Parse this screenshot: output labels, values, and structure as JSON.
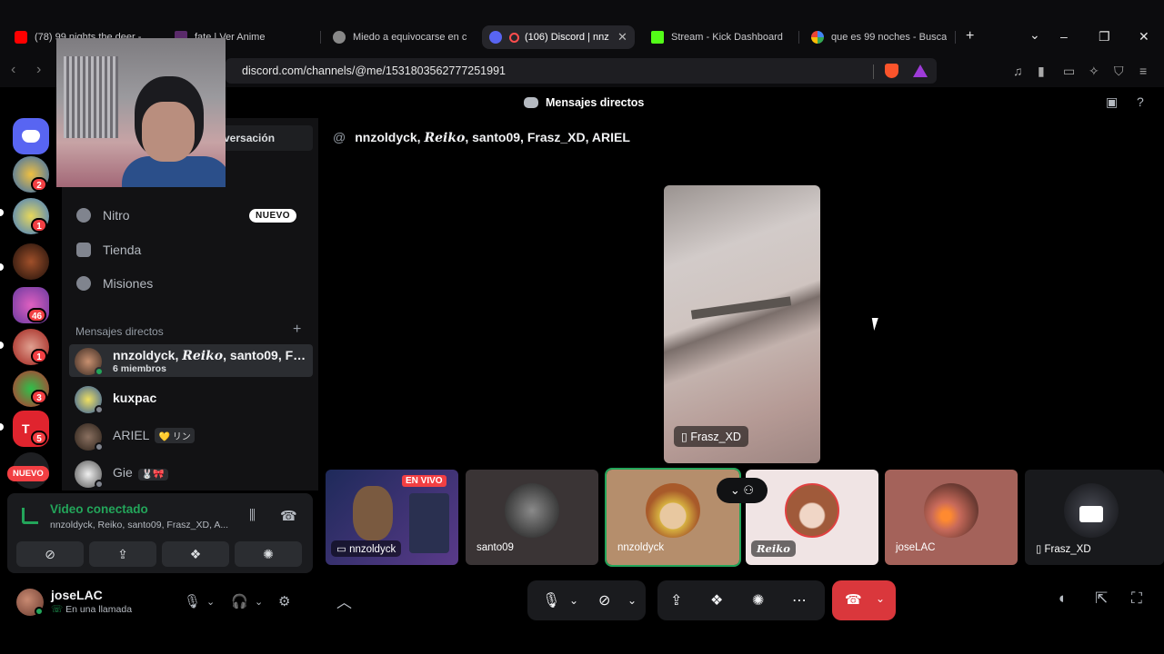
{
  "browser": {
    "tabs": [
      {
        "label": "(78) 99 nights the deer - ",
        "icon_color": "#ff0000"
      },
      {
        "label": "fate | Ver Anime",
        "icon_color": "#5a2a6a"
      },
      {
        "label": "Miedo a equivocarse en c",
        "icon_color": "#888888"
      },
      {
        "label": "(106) Discord | nnz",
        "icon_color": "#5865f2",
        "active": true
      },
      {
        "label": "Stream - Kick Dashboard",
        "icon_color": "#53fc18"
      },
      {
        "label": "que es 99 noches - Busca",
        "icon_color": "#4285f4"
      }
    ],
    "tab_badge": "106",
    "new_tab": "+",
    "url": "discord.com/channels/@me/1531803562777251991",
    "window_controls": {
      "minimize": "–",
      "restore": "❐",
      "close": "✕"
    },
    "dropdown": "⌄"
  },
  "discord": {
    "title": "Mensajes directos",
    "rail": {
      "badges": [
        "2",
        "1",
        "46",
        "1",
        "3",
        "5"
      ],
      "new_label": "NUEVO"
    },
    "sidebar": {
      "conversation_button": "versación",
      "nav": [
        {
          "label": "Nitro",
          "icon": "nitro-icon"
        },
        {
          "label": "Tienda",
          "icon": "shop-icon"
        },
        {
          "label": "Misiones",
          "icon": "quests-icon"
        }
      ],
      "nitro_tag": "NUEVO",
      "dm_header": "Mensajes directos",
      "dm_add": "+",
      "dms": [
        {
          "name_prefix": "nnzoldyck, ",
          "name_reiko": "Reiko",
          "name_suffix": ", santo09, Fra...",
          "sub": "6 miembros",
          "avatar": "#7a4a3a"
        },
        {
          "name": "kuxpac",
          "avatar": "#c9b23a",
          "status": "#80848e"
        },
        {
          "name": "ARIEL",
          "tag": "💛 リン",
          "avatar": "#5c4a3a",
          "status": "#80848e"
        },
        {
          "name": "Gie",
          "tag": "🐰🎀",
          "avatar": "#cfcfcf",
          "status": "#80848e"
        }
      ]
    },
    "voice": {
      "title": "Video conectado",
      "subtitle": "nnzoldyck, Reiko, santo09, Frasz_XD, A...",
      "buttons": [
        "camera-off-icon",
        "screen-share-icon",
        "activities-icon",
        "soundboard-icon"
      ]
    },
    "user": {
      "name": "joseLAC",
      "status": "En una llamada"
    },
    "call": {
      "header_prefix": "nnzoldyck, ",
      "header_reiko": "Reiko",
      "header_suffix": ", santo09, Frasz_XD, ARIEL",
      "focus_name": "Frasz_XD",
      "participants": [
        {
          "name": "nnzoldyck",
          "live": "EN VIVO",
          "bg": "#2a3a6a"
        },
        {
          "name": "santo09",
          "bg": "#3a3435",
          "avatar": "#555"
        },
        {
          "name": "nnzoldyck",
          "bg": "#b58e6c",
          "avatar": "#d6b58a",
          "speaking": true
        },
        {
          "name": "Reiko",
          "bg": "#f0e4e4",
          "avatar": "#a05a3a"
        },
        {
          "name": "joseLAC",
          "bg": "#a4625a",
          "avatar": "#c88a72"
        },
        {
          "name": "Frasz_XD",
          "bg": "#18191c",
          "avatar": "#444"
        }
      ]
    }
  }
}
